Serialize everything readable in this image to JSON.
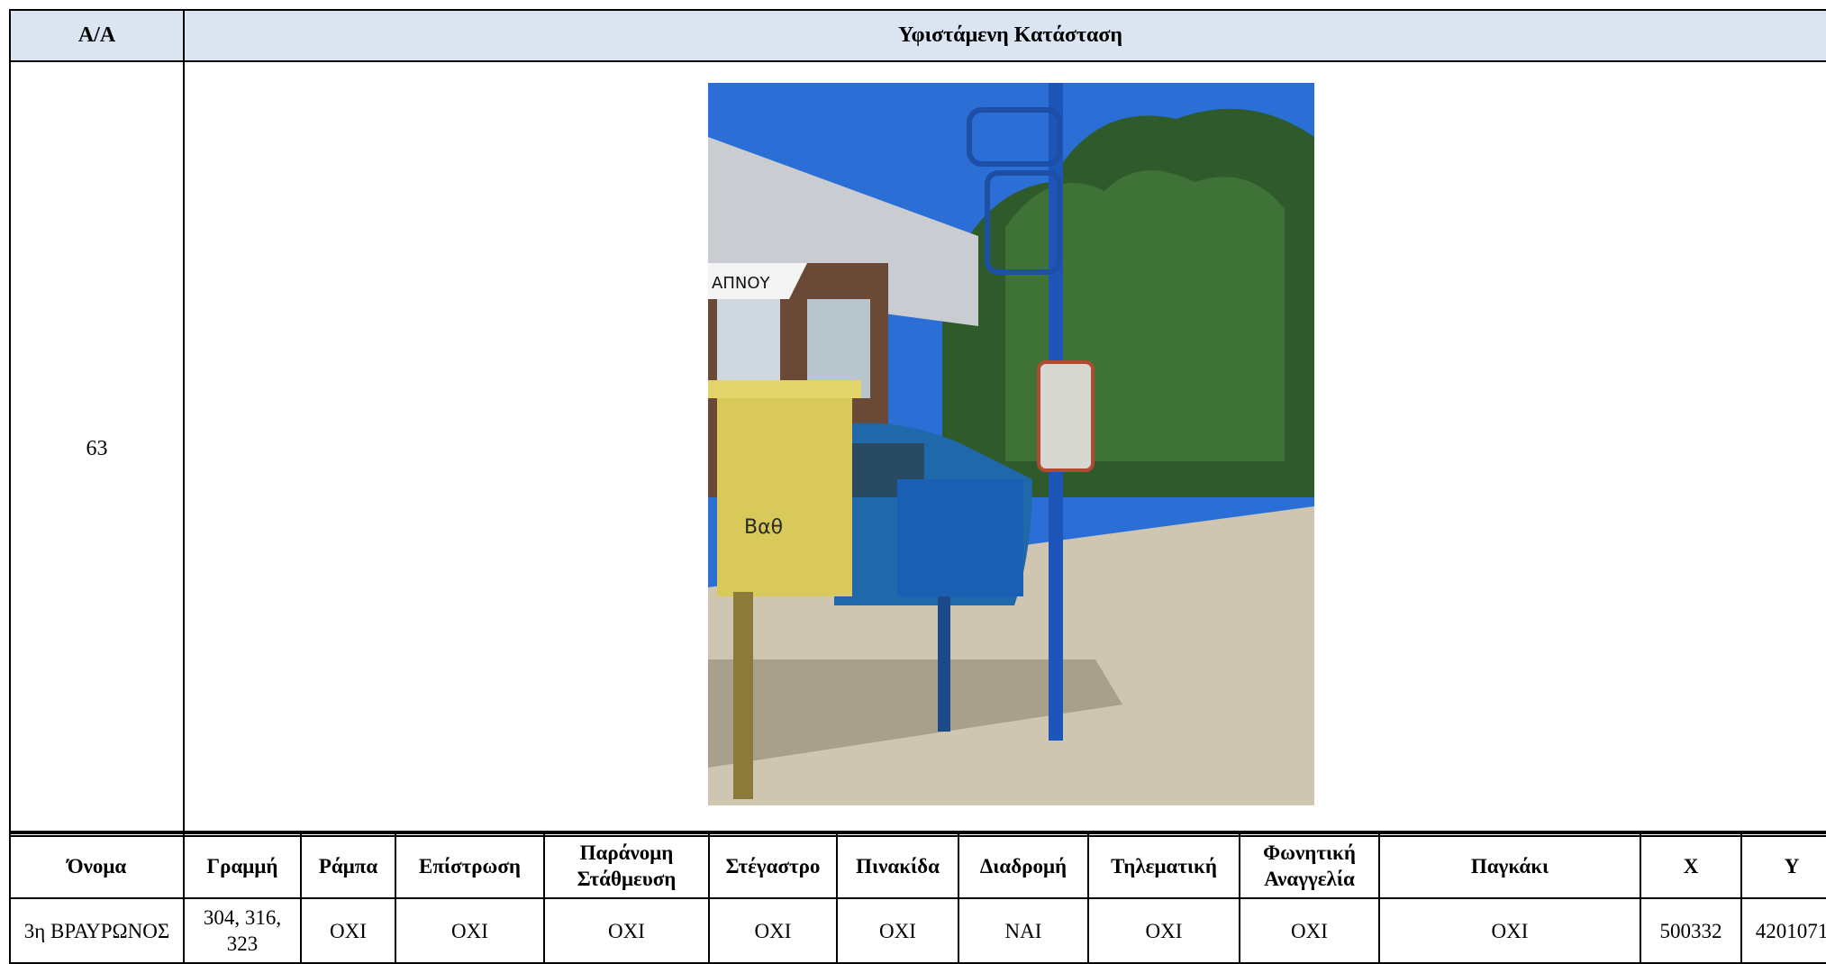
{
  "top_table": {
    "col_aa_header": "A/A",
    "col_state_header": "Υφιστάμενη Κατάσταση",
    "aa_value": "63"
  },
  "photo": {
    "description_icon": "bus-stop-photo",
    "shop_sign_text": "ΑΠΝΟΥ",
    "graffiti_text": "Βαθ"
  },
  "attributes": {
    "headers": [
      "Όνομα",
      "Γραμμή",
      "Ράμπα",
      "Επίστρωση",
      "Παράνομη Στάθμευση",
      "Στέγαστρο",
      "Πινακίδα",
      "Διαδρομή",
      "Τηλεματική",
      "Φωνητική Αναγγελία",
      "Παγκάκι",
      "X",
      "Y"
    ],
    "row": [
      "3η ΒΡΑΥΡΩΝΟΣ",
      "304, 316, 323",
      "ΟΧΙ",
      "ΟΧΙ",
      "ΟΧΙ",
      "ΟΧΙ",
      "ΟΧΙ",
      "ΝΑΙ",
      "ΟΧΙ",
      "ΟΧΙ",
      "ΟΧΙ",
      "500332",
      "4201071"
    ]
  }
}
